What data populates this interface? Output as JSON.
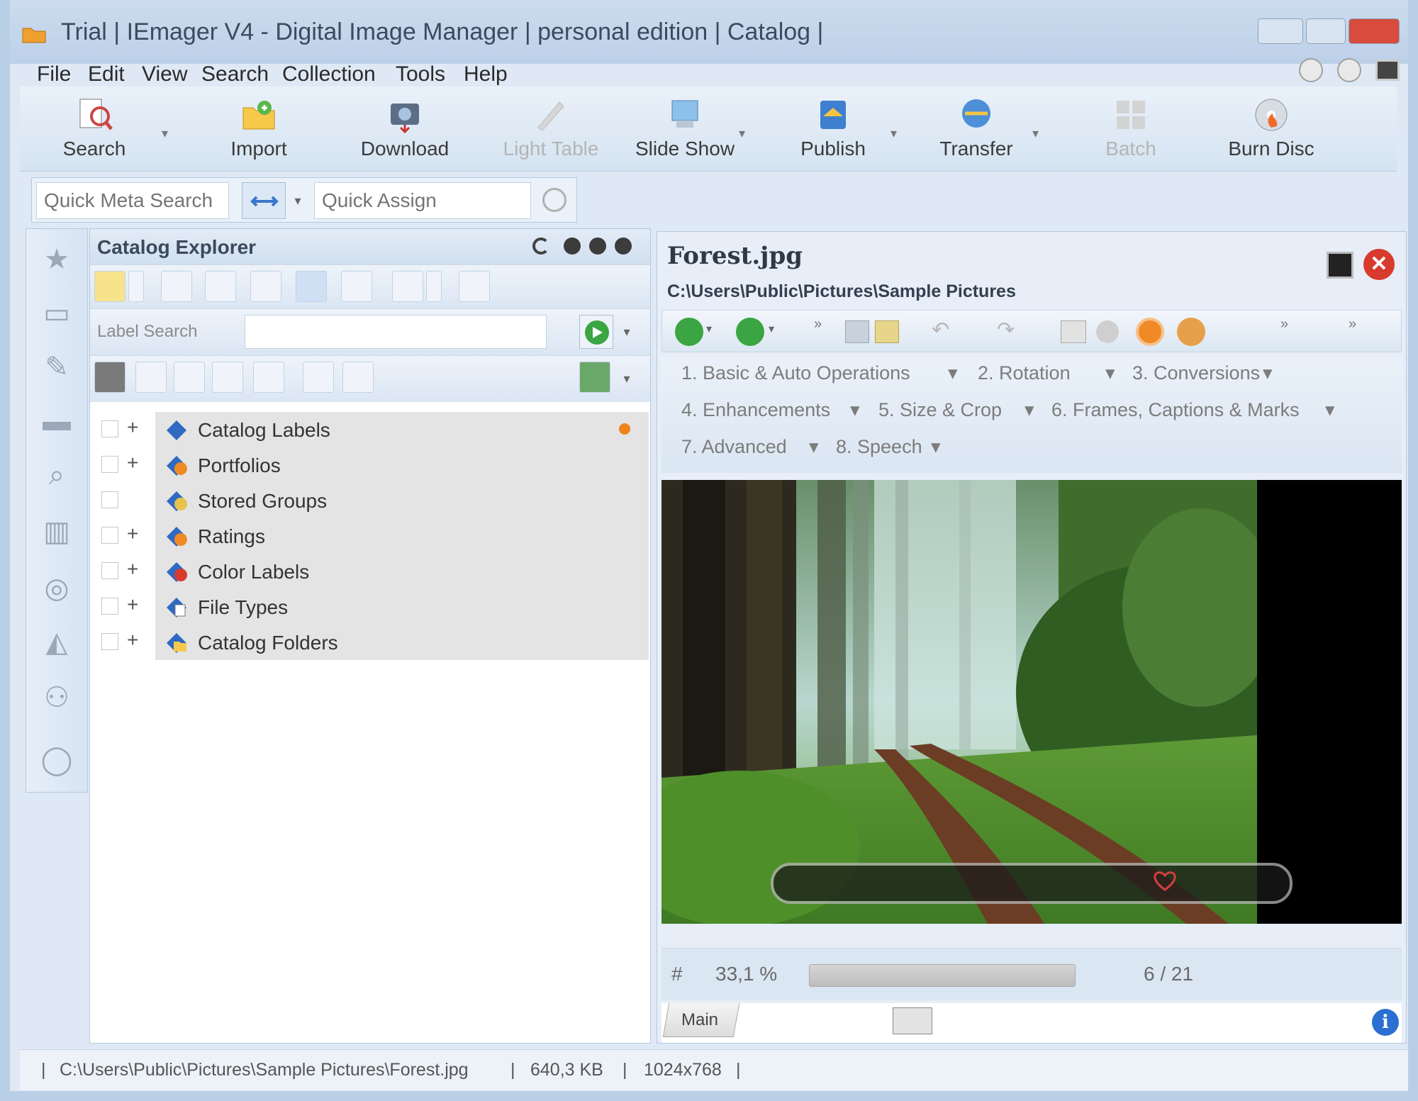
{
  "window": {
    "title": "Trial | IEmager V4 - Digital Image Manager | personal edition | Catalog |"
  },
  "menu": [
    "File",
    "Edit",
    "View",
    "Search",
    "Collection",
    "Tools",
    "Help"
  ],
  "toolbar": [
    {
      "label": "Search",
      "icon": "search-doc-icon",
      "enabled": true
    },
    {
      "label": "Import",
      "icon": "import-folder-icon",
      "enabled": true
    },
    {
      "label": "Download",
      "icon": "download-camera-icon",
      "enabled": true
    },
    {
      "label": "Light Table",
      "icon": "light-table-icon",
      "enabled": false
    },
    {
      "label": "Slide Show",
      "icon": "slideshow-icon",
      "enabled": true
    },
    {
      "label": "Publish",
      "icon": "publish-icon",
      "enabled": true
    },
    {
      "label": "Transfer",
      "icon": "transfer-icon",
      "enabled": true
    },
    {
      "label": "Batch",
      "icon": "batch-icon",
      "enabled": false
    },
    {
      "label": "Burn Disc",
      "icon": "burn-disc-icon",
      "enabled": true
    }
  ],
  "search": {
    "quick_meta_placeholder": "Quick Meta Search",
    "quick_assign_placeholder": "Quick Assign"
  },
  "explorer": {
    "title": "Catalog Explorer",
    "label_search": "Label Search",
    "tree": [
      {
        "label": "Catalog Labels",
        "expandable": true
      },
      {
        "label": "Portfolios",
        "expandable": true
      },
      {
        "label": "Stored Groups",
        "expandable": false
      },
      {
        "label": "Ratings",
        "expandable": true
      },
      {
        "label": "Color Labels",
        "expandable": true
      },
      {
        "label": "File Types",
        "expandable": true
      },
      {
        "label": "Catalog Folders",
        "expandable": true
      }
    ]
  },
  "viewer": {
    "filename": "Forest.jpg",
    "path": "C:\\Users\\Public\\Pictures\\Sample Pictures",
    "operations": [
      "1. Basic & Auto Operations",
      "2. Rotation",
      "3. Conversions",
      "4. Enhancements",
      "5. Size & Crop",
      "6. Frames, Captions & Marks",
      "7. Advanced",
      "8. Speech"
    ],
    "zoom": "33,1 %",
    "position": "6 / 21",
    "hash": "#",
    "tab_label": "Main"
  },
  "status": {
    "path": "C:\\Users\\Public\\Pictures\\Sample Pictures\\Forest.jpg",
    "size": "640,3 KB",
    "dimensions": "1024x768"
  },
  "colors": {
    "accent": "#3b78c9",
    "close_red": "#d83a2e",
    "go_green": "#3aa542",
    "dot_orange": "#f0821e"
  }
}
